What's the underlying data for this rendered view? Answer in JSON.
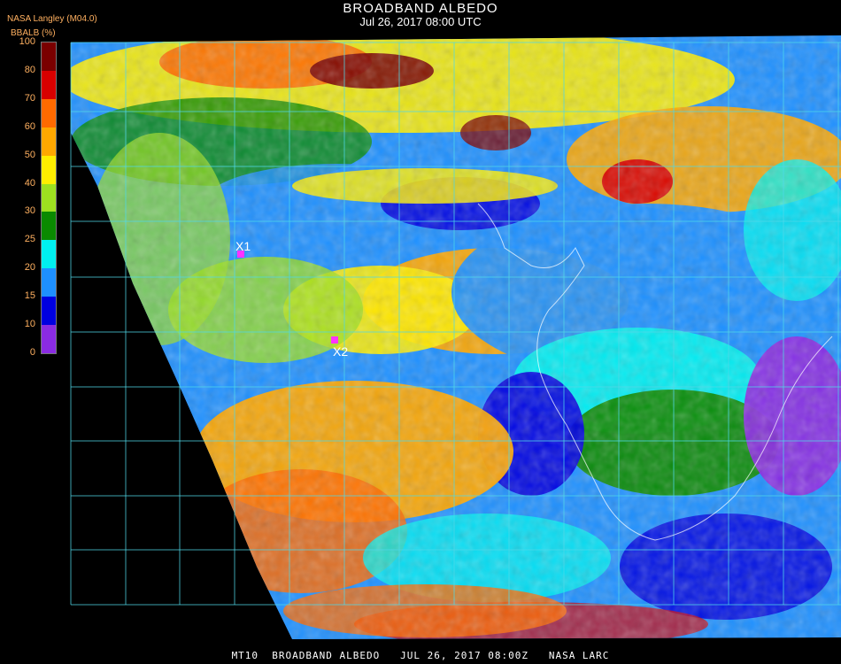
{
  "header": {
    "title": "BROADBAND ALBEDO",
    "subtitle": "Jul 26, 2017 08:00 UTC",
    "brand": "NASA Langley (M04.0)"
  },
  "colorbar": {
    "label": "BBALB (%)",
    "ticks": [
      "100",
      "80",
      "70",
      "60",
      "50",
      "40",
      "30",
      "25",
      "20",
      "15",
      "10",
      "0"
    ],
    "colors": [
      "#7a0000",
      "#d80000",
      "#ff6a00",
      "#ffa800",
      "#ffee00",
      "#9de020",
      "#0a8a00",
      "#00f0f0",
      "#1e90ff",
      "#0000e0",
      "#8a2be2"
    ]
  },
  "markers": [
    {
      "label": "X1",
      "color": "#ff33ff"
    },
    {
      "label": "X2",
      "color": "#ff33ff"
    }
  ],
  "colors": {
    "grid": "#4fd8e8",
    "coast": "#ffffff",
    "background": "#000000"
  },
  "footer": {
    "text": "MT10  BROADBAND ALBEDO   JUL 26, 2017 08:00Z   NASA LARC"
  }
}
